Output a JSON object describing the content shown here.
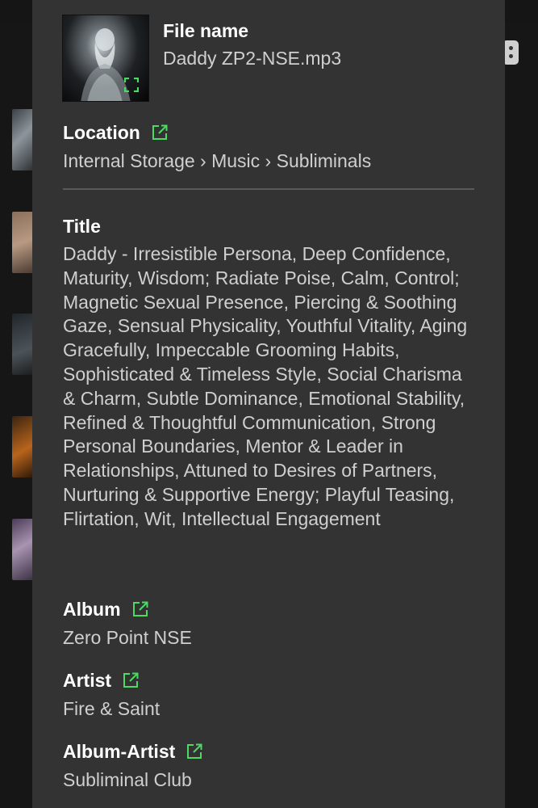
{
  "file": {
    "label": "File name",
    "value": "Daddy ZP2-NSE.mp3"
  },
  "location": {
    "label": "Location",
    "value": "Internal Storage › Music › Subliminals",
    "icon": "external-link-icon"
  },
  "title": {
    "label": "Title",
    "value": "Daddy - Irresistible Persona, Deep Confidence, Maturity, Wisdom; Radiate Poise, Calm, Control; Magnetic Sexual Presence, Piercing & Soothing Gaze, Sensual Physicality, Youthful Vitality, Aging Gracefully, Impeccable Grooming Habits, Sophisticated & Timeless Style, Social Charisma & Charm, Subtle Dominance, Emotional Stability, Refined & Thoughtful Communication, Strong Personal Boundaries, Mentor & Leader in Relationships, Attuned to Desires of Partners, Nurturing & Supportive Energy; Playful Teasing, Flirtation, Wit, Intellectual Engagement"
  },
  "album": {
    "label": "Album",
    "value": "Zero Point NSE",
    "icon": "external-link-icon"
  },
  "artist": {
    "label": "Artist",
    "value": "Fire & Saint",
    "icon": "external-link-icon"
  },
  "album_artist": {
    "label": "Album-Artist",
    "value": "Subliminal Club",
    "icon": "external-link-icon"
  },
  "colors": {
    "sheet_background": "#333333",
    "accent": "#4cd964",
    "label_text": "#ffffff",
    "value_text": "#cfcfcf"
  }
}
